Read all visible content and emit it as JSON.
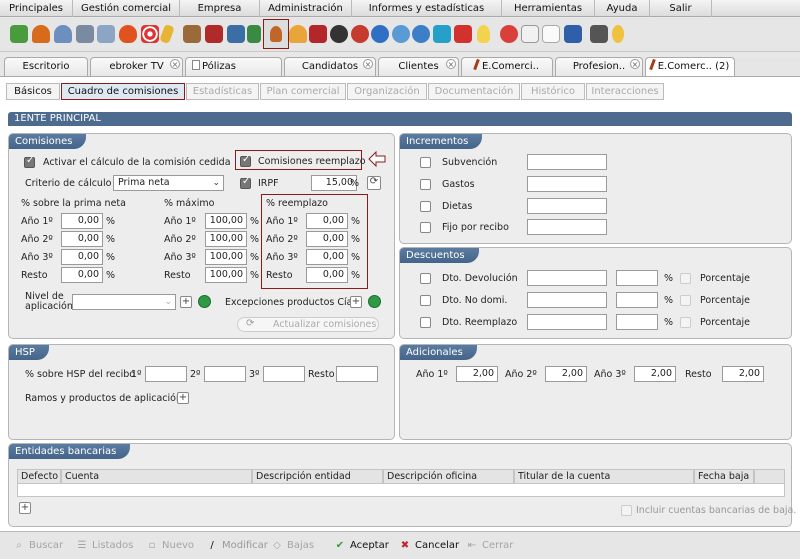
{
  "menu": [
    "Principales",
    "Gestión comercial",
    "Empresa",
    "Administración",
    "Informes y estadísticas",
    "Herramientas",
    "Ayuda",
    "Salir"
  ],
  "toolbar_icons": [
    "box-icon",
    "person-orange-icon",
    "person-blue-icon",
    "monitor-icon",
    "screen-icon",
    "fire-icon",
    "target-icon",
    "pencil-icon",
    "briefcase-icon",
    "bag-icon",
    "car-icon",
    "calculator-icon",
    "agent-icon",
    "person-yellow-icon",
    "arrow-icon",
    "ball-icon",
    "euro-icon",
    "globe-icon",
    "cursor-icon",
    "pie-icon",
    "refresh-icon",
    "g-red-icon",
    "lightbulb-icon",
    "alarm-icon",
    "note-icon",
    "document-icon",
    "phone-icon",
    "pen-icon",
    "help-icon"
  ],
  "open_tabs": [
    {
      "label": "Escritorio",
      "closable": false
    },
    {
      "label": "ebroker TV",
      "closable": true
    },
    {
      "label": "Pólizas",
      "closable": true
    },
    {
      "label": "Candidatos",
      "closable": true
    },
    {
      "label": "Clientes",
      "closable": true
    },
    {
      "label": "E.Comerci..",
      "closable": false
    },
    {
      "label": "Profesion..",
      "closable": true
    },
    {
      "label": "E.Comerc.. (2)",
      "closable": true
    }
  ],
  "sub_tabs": [
    "Básicos",
    "Cuadro de comisiones",
    "Estadísticas",
    "Plan comercial",
    "Organización",
    "Documentación",
    "Histórico",
    "Interacciones"
  ],
  "record_header": "1ENTE PRINCIPAL",
  "comisiones": {
    "title": "Comisiones",
    "activar_label": "Activar el cálculo de la comisión cedida",
    "activar_checked": true,
    "reemplazo_label": "Comisiones reemplazo",
    "reemplazo_checked": true,
    "criterio_label": "Criterio de cálculo",
    "criterio_value": "Prima neta",
    "irpf_checked": true,
    "irpf_label": "IRPF",
    "irpf_value": "15,00",
    "pct_sign": "%",
    "col1_label": "% sobre la prima neta",
    "col2_label": "% máximo",
    "col3_label": "% reemplazo",
    "rows": [
      {
        "label": "Año 1º",
        "prima": "0,00",
        "maximo": "100,00",
        "reemplazo": "0,00"
      },
      {
        "label": "Año 2º",
        "prima": "0,00",
        "maximo": "100,00",
        "reemplazo": "0,00"
      },
      {
        "label": "Año 3º",
        "prima": "0,00",
        "maximo": "100,00",
        "reemplazo": "0,00"
      },
      {
        "label": "Resto",
        "prima": "0,00",
        "maximo": "100,00",
        "reemplazo": "0,00"
      }
    ],
    "nivel_label_1": "Nivel de",
    "nivel_label_2": "aplicación",
    "excepciones_label": "Excepciones productos Cía.",
    "actualizar_label": "Actualizar comisiones"
  },
  "incrementos": {
    "title": "Incrementos",
    "items": [
      "Subvención",
      "Gastos",
      "Dietas",
      "Fijo por recibo"
    ]
  },
  "descuentos": {
    "title": "Descuentos",
    "items": [
      "Dto. Devolución",
      "Dto. No domi.",
      "Dto. Reemplazo"
    ],
    "pct_sign": "%",
    "porcentaje_label": "Porcentaje"
  },
  "hsp": {
    "title": "HSP",
    "recibo_label": "% sobre HSP del recibo",
    "fields": [
      "1º",
      "2º",
      "3º",
      "Resto"
    ],
    "ramos_label": "Ramos y productos de aplicación"
  },
  "adicionales": {
    "title": "Adicionales",
    "fields": [
      {
        "label": "Año 1º",
        "value": "2,00"
      },
      {
        "label": "Año 2º",
        "value": "2,00"
      },
      {
        "label": "Año 3º",
        "value": "2,00"
      },
      {
        "label": "Resto",
        "value": "2,00"
      }
    ]
  },
  "bancarias": {
    "title": "Entidades bancarias",
    "columns": [
      "Defecto",
      "Cuenta",
      "Descripción entidad",
      "Descripción oficina",
      "Titular de la cuenta",
      "Fecha baja"
    ],
    "incluir_label": "Incluir cuentas bancarias de baja."
  },
  "bottom_buttons": [
    {
      "label": "Buscar",
      "icon": "search-icon",
      "enabled": false
    },
    {
      "label": "Listados",
      "icon": "list-icon",
      "enabled": false
    },
    {
      "label": "Nuevo",
      "icon": "new-icon",
      "enabled": false
    },
    {
      "label": "Modificar",
      "icon": "edit-icon",
      "enabled": true
    },
    {
      "label": "Bajas",
      "icon": "eraser-icon",
      "enabled": false
    },
    {
      "label": "Aceptar",
      "icon": "check-icon",
      "enabled": true
    },
    {
      "label": "Cancelar",
      "icon": "x-icon",
      "enabled": true
    },
    {
      "label": "Cerrar",
      "icon": "close-icon",
      "enabled": false
    }
  ]
}
